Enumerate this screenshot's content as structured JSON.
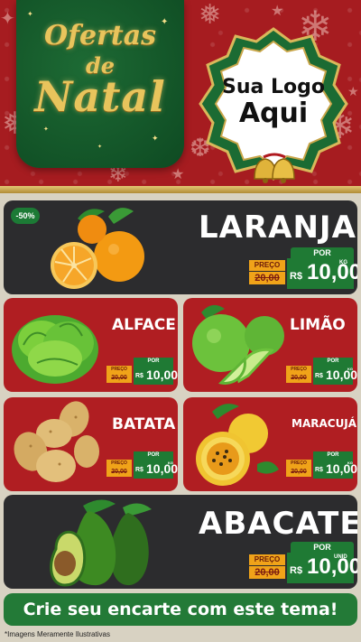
{
  "header": {
    "title_line1": "Ofertas",
    "title_line2": "de",
    "title_line3": "Natal",
    "logo_line1": "Sua Logo",
    "logo_line2": "Aqui",
    "bell_icon": "christmas-bells-icon",
    "colors": {
      "red": "#a61c20",
      "green": "#0e4a22",
      "gold": "#e8c45c"
    }
  },
  "products": [
    {
      "name": "LARANJA",
      "badge": "-50%",
      "por_label": "POR",
      "preco_label": "PREÇO",
      "old_price": "20,00",
      "currency": "R$",
      "price": "10,00",
      "unit": "KG",
      "image": "orange-fruit-image"
    },
    {
      "name": "ALFACE",
      "por_label": "POR",
      "preco_label": "PREÇO",
      "old_price": "20,00",
      "currency": "R$",
      "price": "10,00",
      "unit": "",
      "image": "lettuce-image"
    },
    {
      "name": "LIMÃO",
      "por_label": "POR",
      "preco_label": "PREÇO",
      "old_price": "20,00",
      "currency": "R$",
      "price": "10,00",
      "unit": "KG",
      "image": "lime-image"
    },
    {
      "name": "BATATA",
      "por_label": "POR",
      "preco_label": "PREÇO",
      "old_price": "20,00",
      "currency": "R$",
      "price": "10,00",
      "unit": "KG",
      "image": "potato-image"
    },
    {
      "name": "MARACUJÁ",
      "por_label": "POR",
      "preco_label": "PREÇO",
      "old_price": "20,00",
      "currency": "R$",
      "price": "10,00",
      "unit": "KG",
      "image": "passion-fruit-image"
    },
    {
      "name": "ABACATE",
      "por_label": "POR",
      "preco_label": "PREÇO",
      "old_price": "20,00",
      "currency": "R$",
      "price": "10,00",
      "unit": "UNID",
      "image": "avocado-image"
    }
  ],
  "footer": {
    "cta": "Crie seu encarte com este tema!",
    "disclaimer": "*Imagens Meramente Ilustrativas"
  }
}
